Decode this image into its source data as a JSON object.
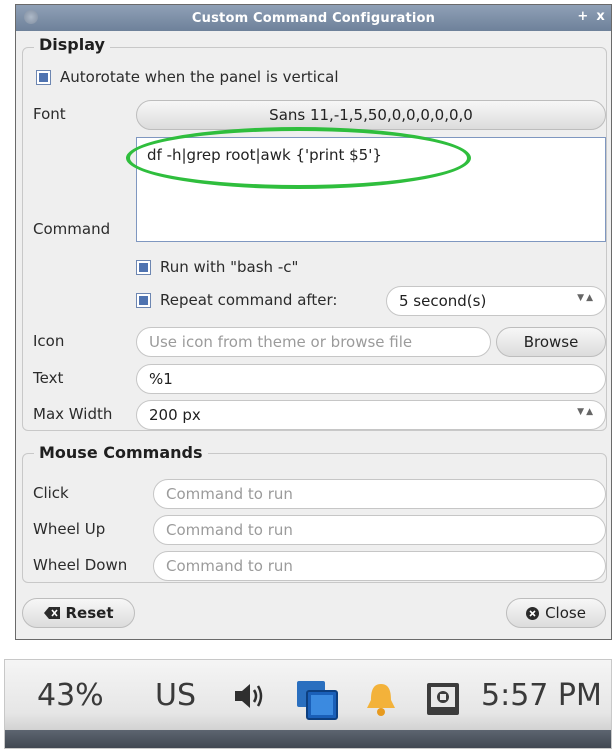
{
  "window": {
    "title": "Custom Command Configuration",
    "controls": [
      "+",
      "x"
    ]
  },
  "display": {
    "section_title": "Display",
    "autorotate_label": "Autorotate when the panel is vertical",
    "autorotate_checked": true,
    "font_label": "Font",
    "font_value": "Sans 11,-1,5,50,0,0,0,0,0,0",
    "command_label": "Command",
    "command_value": "df -h|grep root|awk {'print $5'}",
    "run_bash_label": "Run with \"bash -c\"",
    "run_bash_checked": true,
    "repeat_label": "Repeat command after:",
    "repeat_checked": true,
    "repeat_value": "5 second(s)",
    "icon_label": "Icon",
    "icon_placeholder": "Use icon from theme or browse file",
    "browse_label": "Browse",
    "text_label": "Text",
    "text_value": "%1",
    "max_width_label": "Max Width",
    "max_width_value": "200 px"
  },
  "mouse": {
    "section_title": "Mouse Commands",
    "click_label": "Click",
    "wheel_up_label": "Wheel Up",
    "wheel_down_label": "Wheel Down",
    "placeholder": "Command to run"
  },
  "footer": {
    "reset_label": "Reset",
    "close_label": "Close"
  },
  "taskbar": {
    "battery": "43%",
    "keyboard_layout": "US",
    "clock": "5:57 PM",
    "icons": [
      "volume-icon",
      "windows-icon",
      "bell-icon",
      "custom-command-icon"
    ]
  },
  "colors": {
    "accent_blue": "#4f73b0",
    "highlight_green": "#2fbe3d",
    "titlebar": "#7b8ca3"
  }
}
